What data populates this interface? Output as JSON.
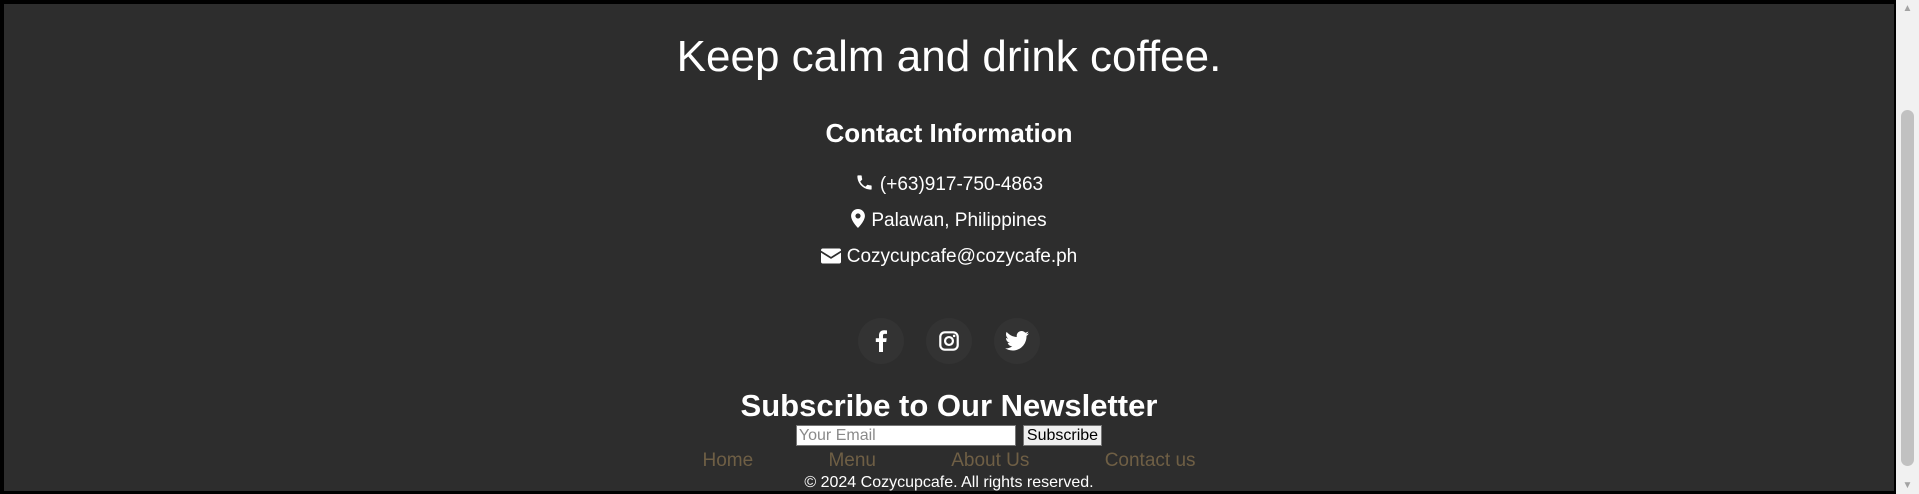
{
  "tagline": "Keep calm and drink coffee.",
  "contact": {
    "heading": "Contact Information",
    "phone": "(+63)917-750-4863",
    "location": "Palawan, Philippines",
    "email": "Cozycupcafe@cozycafe.ph"
  },
  "socials": {
    "facebook": "facebook-icon",
    "instagram": "instagram-icon",
    "twitter": "twitter-icon"
  },
  "newsletter": {
    "heading": "Subscribe to Our Newsletter",
    "email_placeholder": "Your Email",
    "subscribe_label": "Subscribe"
  },
  "nav": {
    "home": "Home",
    "menu": "Menu",
    "about": "About Us",
    "contact": "Contact us"
  },
  "copyright": "© 2024 Cozycupcafe. All rights reserved.",
  "colors": {
    "footer_bg": "#2d2d2d",
    "nav_link": "#6f5f45",
    "text": "#ffffff"
  }
}
